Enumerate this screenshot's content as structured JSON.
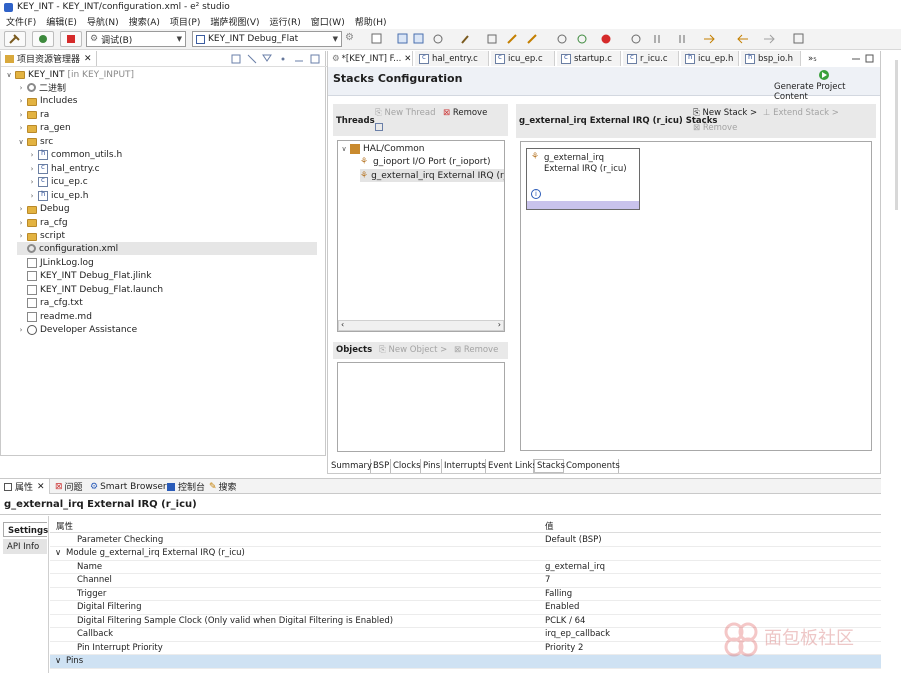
{
  "window": {
    "title": "KEY_INT - KEY_INT/configuration.xml - e² studio"
  },
  "menu": [
    "文件(F)",
    "编辑(E)",
    "导航(N)",
    "搜索(A)",
    "项目(P)",
    "瑞萨视图(V)",
    "运行(R)",
    "窗口(W)",
    "帮助(H)"
  ],
  "toolbar": {
    "mode_combo": "调试(B)",
    "config_combo": "KEY_INT Debug_Flat"
  },
  "project_explorer": {
    "tab_label": "项目资源管理器",
    "project": {
      "name": "KEY_INT",
      "suffix": "[in KEY_INPUT]"
    },
    "items": [
      {
        "label": "二进制",
        "icon": "binary-icon"
      },
      {
        "label": "Includes",
        "icon": "includes-icon"
      },
      {
        "label": "ra",
        "icon": "folder-icon"
      },
      {
        "label": "ra_gen",
        "icon": "folder-icon"
      },
      {
        "label": "src",
        "icon": "folder-icon"
      },
      {
        "label": "common_utils.h",
        "icon": "h-file-icon"
      },
      {
        "label": "hal_entry.c",
        "icon": "c-file-icon"
      },
      {
        "label": "icu_ep.c",
        "icon": "c-file-icon"
      },
      {
        "label": "icu_ep.h",
        "icon": "h-file-icon"
      },
      {
        "label": "Debug",
        "icon": "folder-icon"
      },
      {
        "label": "ra_cfg",
        "icon": "folder-icon"
      },
      {
        "label": "script",
        "icon": "folder-icon"
      },
      {
        "label": "configuration.xml",
        "icon": "gear-icon"
      },
      {
        "label": "JLinkLog.log",
        "icon": "file-icon"
      },
      {
        "label": "KEY_INT Debug_Flat.jlink",
        "icon": "file-icon"
      },
      {
        "label": "KEY_INT Debug_Flat.launch",
        "icon": "launch-file-icon"
      },
      {
        "label": "ra_cfg.txt",
        "icon": "file-icon"
      },
      {
        "label": "readme.md",
        "icon": "file-icon"
      },
      {
        "label": "Developer Assistance",
        "icon": "help-icon"
      }
    ]
  },
  "editor_tabs": [
    "*[KEY_INT] F...",
    "hal_entry.c",
    "icu_ep.c",
    "startup.c",
    "r_icu.c",
    "icu_ep.h",
    "bsp_io.h",
    "»₅"
  ],
  "stacks": {
    "header": "Stacks Configuration",
    "generate_label": "Generate Project Content",
    "threads_label": "Threads",
    "new_thread": "New Thread",
    "remove": "Remove",
    "hal_common": "HAL/Common",
    "thread_items": [
      "g_ioport I/O Port (r_ioport)",
      "g_external_irq External IRQ (r_icu)"
    ],
    "stacks_title": "g_external_irq External IRQ (r_icu) Stacks",
    "new_stack": "New Stack >",
    "extend_stack": "Extend Stack >",
    "stack_remove": "Remove",
    "stack_block": "g_external_irq External IRQ (r_icu)",
    "objects_label": "Objects",
    "new_object": "New Object >",
    "object_remove": "Remove",
    "bottom_tabs": [
      "Summary",
      "BSP",
      "Clocks",
      "Pins",
      "Interrupts",
      "Event Links",
      "Stacks",
      "Components"
    ]
  },
  "bottom_panel": {
    "tabs": [
      "属性",
      "问题",
      "Smart Browser",
      "控制台",
      "搜索"
    ],
    "title": "g_external_irq External IRQ (r_icu)",
    "side_tabs": [
      "Settings",
      "API Info"
    ],
    "col_property": "属性",
    "col_value": "值",
    "rows": [
      {
        "k": "Parameter Checking",
        "v": "Default (BSP)",
        "indent": 2
      },
      {
        "k": "Module g_external_irq External IRQ (r_icu)",
        "v": "",
        "indent": 1,
        "chev": "down"
      },
      {
        "k": "Name",
        "v": "g_external_irq",
        "indent": 2
      },
      {
        "k": "Channel",
        "v": "7",
        "indent": 2
      },
      {
        "k": "Trigger",
        "v": "Falling",
        "indent": 2
      },
      {
        "k": "Digital Filtering",
        "v": "Enabled",
        "indent": 2
      },
      {
        "k": "Digital Filtering Sample Clock (Only valid when Digital Filtering is Enabled)",
        "v": "PCLK / 64",
        "indent": 2
      },
      {
        "k": "Callback",
        "v": "irq_ep_callback",
        "indent": 2
      },
      {
        "k": "Pin Interrupt Priority",
        "v": "Priority 2",
        "indent": 2
      },
      {
        "k": "Pins",
        "v": "",
        "indent": 1,
        "chev": "down",
        "selected": true
      }
    ]
  },
  "watermark": "面包板社区"
}
